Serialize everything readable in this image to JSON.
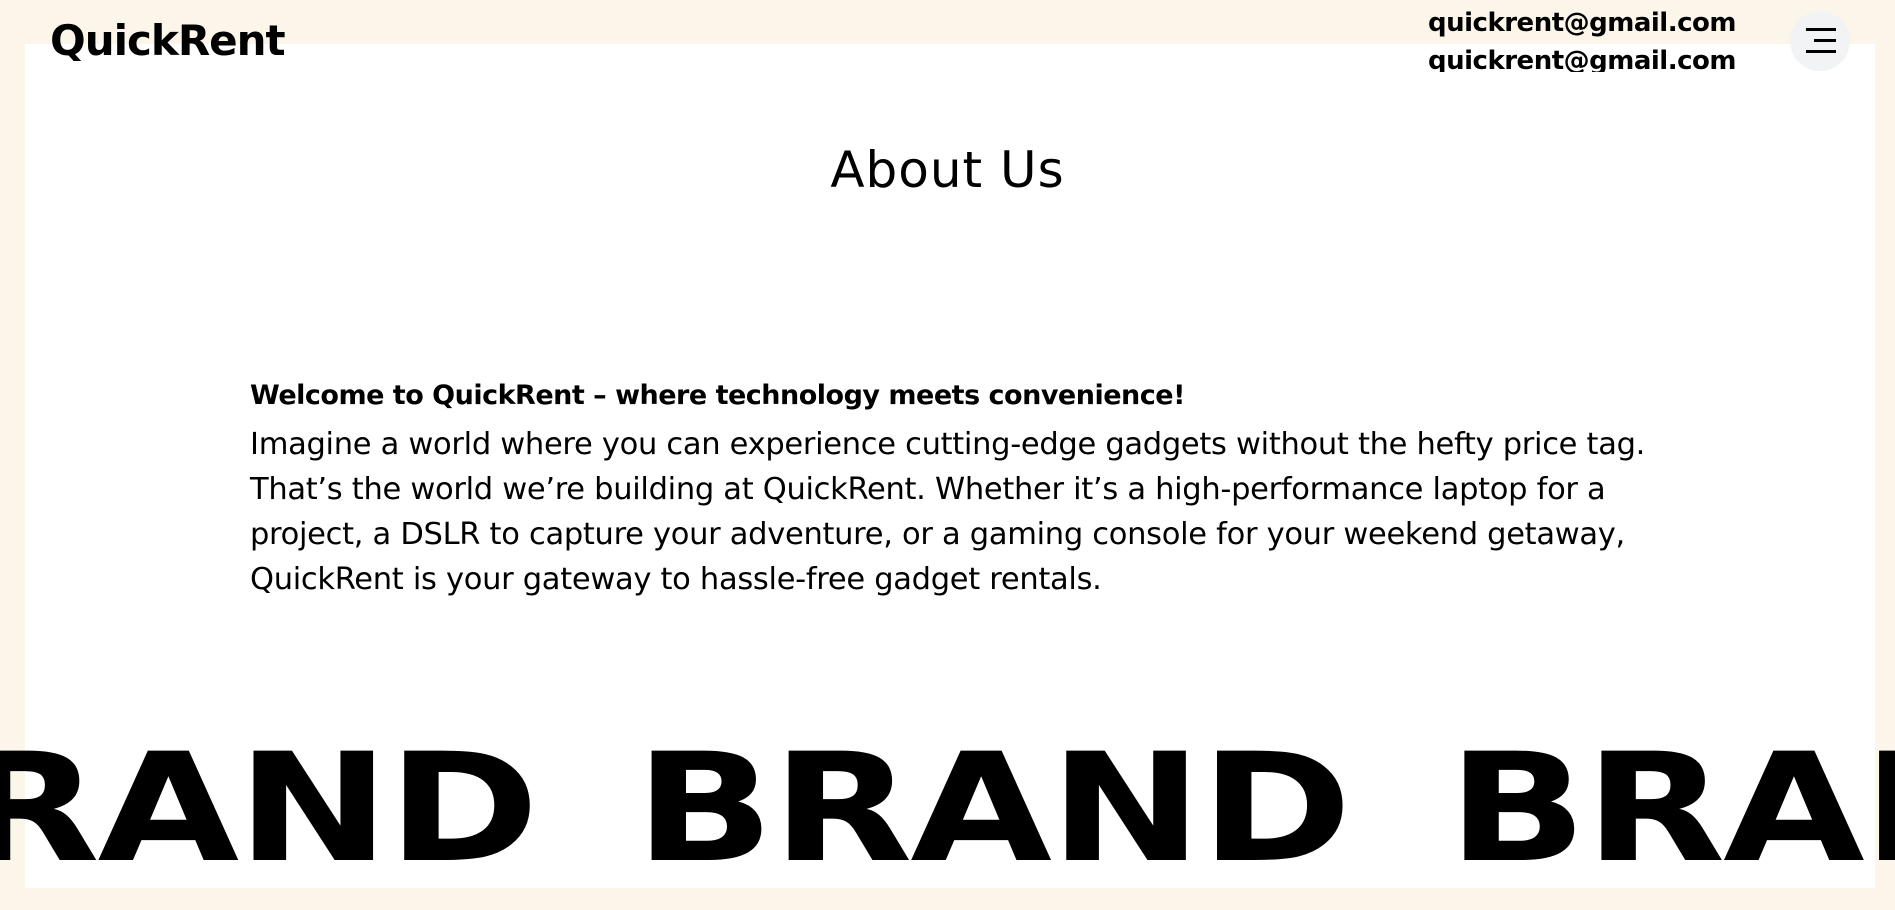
{
  "header": {
    "brand": "QuickRent",
    "emails": [
      "quickrent@gmail.com",
      "quickrent@gmail.com"
    ],
    "menu_icon": "menu-icon"
  },
  "main": {
    "title": "About Us",
    "intro_heading": "Welcome to QuickRent – where technology meets convenience!",
    "intro_text": "Imagine a world where you can experience cutting-edge gadgets without the hefty price tag. That’s the world we’re building at QuickRent. Whether it’s a high-performance laptop for a project, a DSLR to capture your adventure, or a gaming console for your weekend getaway, QuickRent is your gateway to hassle-free gadget rentals."
  },
  "marquee": {
    "words": [
      "BRAND",
      "BRAND",
      "BRAND"
    ]
  },
  "colors": {
    "page_background": "#fcf6ea",
    "card_background": "#ffffff",
    "menu_button_background": "#f2f3f5",
    "text": "#000000"
  }
}
